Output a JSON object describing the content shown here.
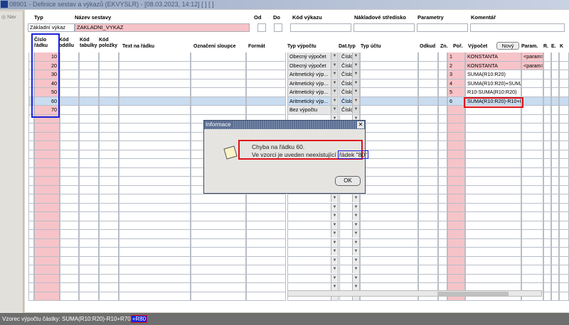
{
  "window": {
    "title": "08901 - Definice sestav a výkazů (EKVYSLR) - [08.03.2023, 14:12]  [ ]  [ ]"
  },
  "nav": {
    "label": "Nav"
  },
  "header": {
    "labels": {
      "typ": "Typ",
      "nazev": "Název sestavy",
      "od": "Od",
      "do": "Do",
      "kod_vykazu": "Kód výkazu",
      "nakladove": "Nákladové středisko",
      "parametry": "Parametry",
      "komentar": "Komentář"
    },
    "values": {
      "typ": "Základní výkaz",
      "nazev": "ZAKLADNI_VYKAZ",
      "od": "",
      "do": "",
      "kod_vykazu": "",
      "nakladove": "",
      "parametry": "",
      "komentar": ""
    }
  },
  "grid": {
    "columns": {
      "cislo": "Číslo řádku",
      "oddil": "Kód oddílu",
      "tabulka": "Kód tabulky",
      "polozka": "Kód položky",
      "text": "Text na řádku",
      "oznaceni": "Označení sloupce",
      "format": "Formát",
      "typ_vypoctu": "Typ výpočtu",
      "dat_typ": "Dat.typ",
      "typ_uctu": "Typ účtu",
      "odkud": "Odkud",
      "zn": "Zn.",
      "por": "Poř.",
      "vypocet": "Výpočet",
      "novy": "Nový",
      "param": "Param.",
      "r": "R.",
      "e": "E.",
      "k": "K"
    },
    "rows": [
      {
        "cislo": "10",
        "typ_vypoctu": "Obecný výpočet",
        "dat_typ": "Číslo",
        "por": "1",
        "vypocet": "KONSTANTA",
        "param": "<param>"
      },
      {
        "cislo": "20",
        "typ_vypoctu": "Obecný výpočet",
        "dat_typ": "Číslo",
        "por": "2",
        "vypocet": "KONSTANTA",
        "param": "<param>"
      },
      {
        "cislo": "30",
        "typ_vypoctu": "Aritmetický výp...",
        "dat_typ": "Číslo",
        "por": "3",
        "vypocet": "SUMA(R10:R20)",
        "param": ""
      },
      {
        "cislo": "40",
        "typ_vypoctu": "Aritmetický výp...",
        "dat_typ": "Číslo",
        "por": "4",
        "vypocet": "SUMA(R10:R20)+SUMA",
        "param": ""
      },
      {
        "cislo": "50",
        "typ_vypoctu": "Aritmetický výp...",
        "dat_typ": "Číslo",
        "por": "5",
        "vypocet": "R10-SUMA(R10:R20)",
        "param": ""
      },
      {
        "cislo": "60",
        "typ_vypoctu": "Aritmetický výp...",
        "dat_typ": "Číslo",
        "por": "6",
        "vypocet": "SUMA(R10:R20)-R10+R",
        "param": ""
      },
      {
        "cislo": "70",
        "typ_vypoctu": "Bez výpočtu",
        "dat_typ": "Číslo",
        "por": "",
        "vypocet": "",
        "param": ""
      }
    ]
  },
  "dialog": {
    "title": "Informace",
    "line1": "Chyba na řádku 60.",
    "line2": "Ve vzorci je uveden neexistující",
    "highlight": "řádek \"80\"",
    "ok": "OK"
  },
  "status": {
    "text": "Vzorec výpočtu částky: SUMA(R10:R20)-R10+R70",
    "highlight": "+R80"
  }
}
